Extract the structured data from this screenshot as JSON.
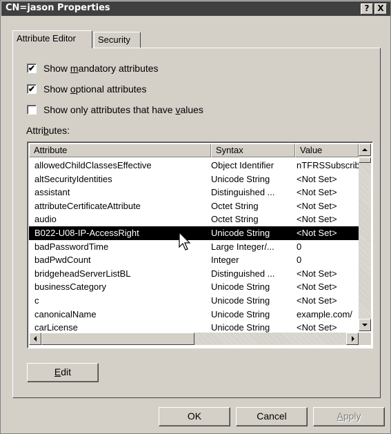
{
  "window": {
    "title": "CN=jason Properties",
    "help_glyph": "?",
    "close_glyph": "X"
  },
  "tabs": [
    {
      "label": "Attribute Editor",
      "active": true
    },
    {
      "label": "Security",
      "active": false
    }
  ],
  "options": {
    "mandatory": {
      "prefix": "Show ",
      "mnemonic": "m",
      "rest": "andatory attributes",
      "checked": true
    },
    "optional": {
      "prefix": "Show ",
      "mnemonic": "o",
      "rest": "ptional attributes",
      "checked": true
    },
    "only_values": {
      "prefix": "Show only attributes that have ",
      "mnemonic": "v",
      "rest": "alues",
      "checked": false
    }
  },
  "attributes_label": {
    "prefix": "Attri",
    "mnemonic": "b",
    "rest": "utes:"
  },
  "table": {
    "columns": [
      "Attribute",
      "Syntax",
      "Value"
    ],
    "rows": [
      {
        "attribute": "allowedChildClassesEffective",
        "syntax": "Object Identifier",
        "value": "nTFRSSubscriber",
        "selected": false
      },
      {
        "attribute": "altSecurityIdentities",
        "syntax": "Unicode String",
        "value": "<Not Set>",
        "selected": false
      },
      {
        "attribute": "assistant",
        "syntax": "Distinguished ...",
        "value": "<Not Set>",
        "selected": false
      },
      {
        "attribute": "attributeCertificateAttribute",
        "syntax": "Octet String",
        "value": "<Not Set>",
        "selected": false
      },
      {
        "attribute": "audio",
        "syntax": "Octet String",
        "value": "<Not Set>",
        "selected": false
      },
      {
        "attribute": "B022-U08-IP-AccessRight",
        "syntax": "Unicode String",
        "value": "<Not Set>",
        "selected": true
      },
      {
        "attribute": "badPasswordTime",
        "syntax": "Large Integer/...",
        "value": "0",
        "selected": false
      },
      {
        "attribute": "badPwdCount",
        "syntax": "Integer",
        "value": "0",
        "selected": false
      },
      {
        "attribute": "bridgeheadServerListBL",
        "syntax": "Distinguished ...",
        "value": "<Not Set>",
        "selected": false
      },
      {
        "attribute": "businessCategory",
        "syntax": "Unicode String",
        "value": "<Not Set>",
        "selected": false
      },
      {
        "attribute": "c",
        "syntax": "Unicode String",
        "value": "<Not Set>",
        "selected": false
      },
      {
        "attribute": "canonicalName",
        "syntax": "Unicode String",
        "value": "example.com/",
        "selected": false
      },
      {
        "attribute": "carLicense",
        "syntax": "Unicode String",
        "value": "<Not Set>",
        "selected": false
      }
    ]
  },
  "buttons": {
    "edit": {
      "mnemonic": "E",
      "rest": "dit"
    },
    "ok": "OK",
    "cancel": "Cancel",
    "apply": {
      "mnemonic": "A",
      "rest": "pply",
      "disabled": true
    }
  },
  "colors": {
    "face": "#d4d0c8",
    "titlebar": "#404040",
    "selection": "#000000"
  }
}
